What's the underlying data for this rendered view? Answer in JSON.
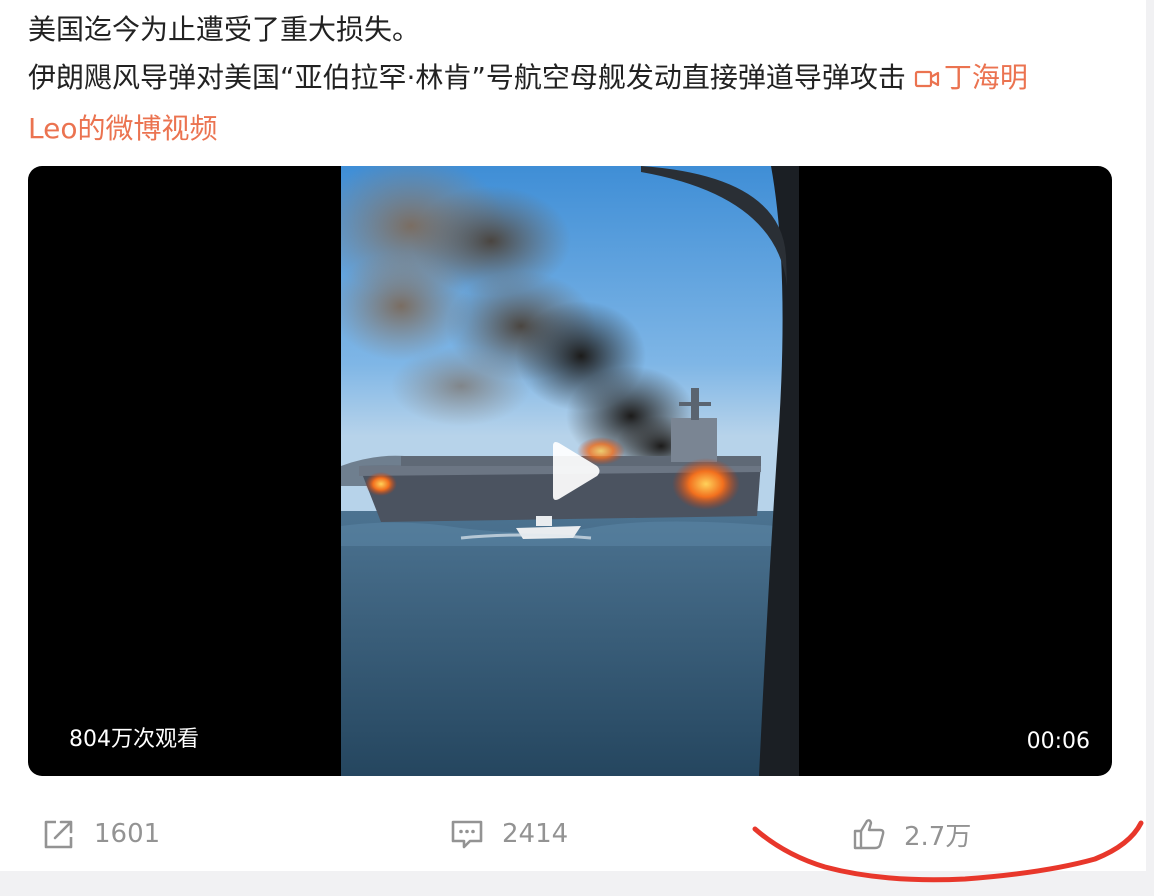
{
  "post": {
    "line1": "美国迄今为止遭受了重大损失。",
    "line2_text": "伊朗飓风导弹对美国“亚伯拉罕·林肯”号航空母舰发动直接弹道导弹攻击",
    "video_link_part1": "丁海明",
    "video_link_part2": "Leo的微博视频",
    "link_color": "#eb7350"
  },
  "video": {
    "views": "804万次观看",
    "duration": "00:06",
    "play_icon": "play-icon"
  },
  "actions": {
    "repost_count": "1601",
    "comment_count": "2414",
    "like_count": "2.7万",
    "repost_icon": "share-icon",
    "comment_icon": "comment-icon",
    "like_icon": "thumbs-up-icon"
  },
  "annotation": {
    "color": "#e8372b"
  }
}
